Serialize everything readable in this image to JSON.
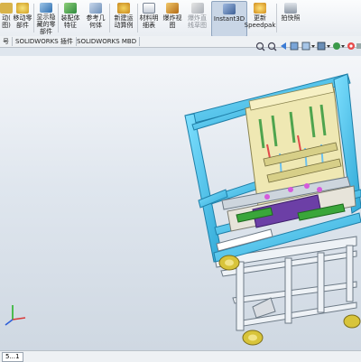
{
  "ribbon": {
    "buttons": [
      {
        "id": "partial-left",
        "label": "动(\n图)"
      },
      {
        "id": "move-component",
        "label": "移动零\n部件"
      },
      {
        "id": "show-hidden",
        "label": "显示隐\n藏的零\n部件"
      },
      {
        "id": "assembly-feature",
        "label": "装配体\n特征"
      },
      {
        "id": "reference-geometry",
        "label": "参考几\n何体"
      },
      {
        "id": "new-motion-study",
        "label": "新建运\n动算例"
      },
      {
        "id": "bom",
        "label": "材料明\n细表"
      },
      {
        "id": "explode-view",
        "label": "爆炸视\n图"
      },
      {
        "id": "explode-line-sketch",
        "label": "爆炸直\n线草图"
      },
      {
        "id": "instant3d",
        "label": "Instant3D"
      },
      {
        "id": "update-speedpak",
        "label": "更新\nSpeedpak"
      },
      {
        "id": "snapshot",
        "label": "拍快照"
      }
    ]
  },
  "tabs": [
    {
      "label": "号"
    },
    {
      "label": "SOLIDWORKS 插件"
    },
    {
      "label": "SOLIDWORKS MBD"
    }
  ],
  "status": {
    "tab_label": "5...1"
  },
  "colors": {
    "frame": "#5ad0f0",
    "frame_dark": "#2a9fcd",
    "inner_panel": "#f0e9b8",
    "green": "#3aa63a",
    "purple": "#6c3fa6",
    "wheel": "#d8c43a"
  }
}
